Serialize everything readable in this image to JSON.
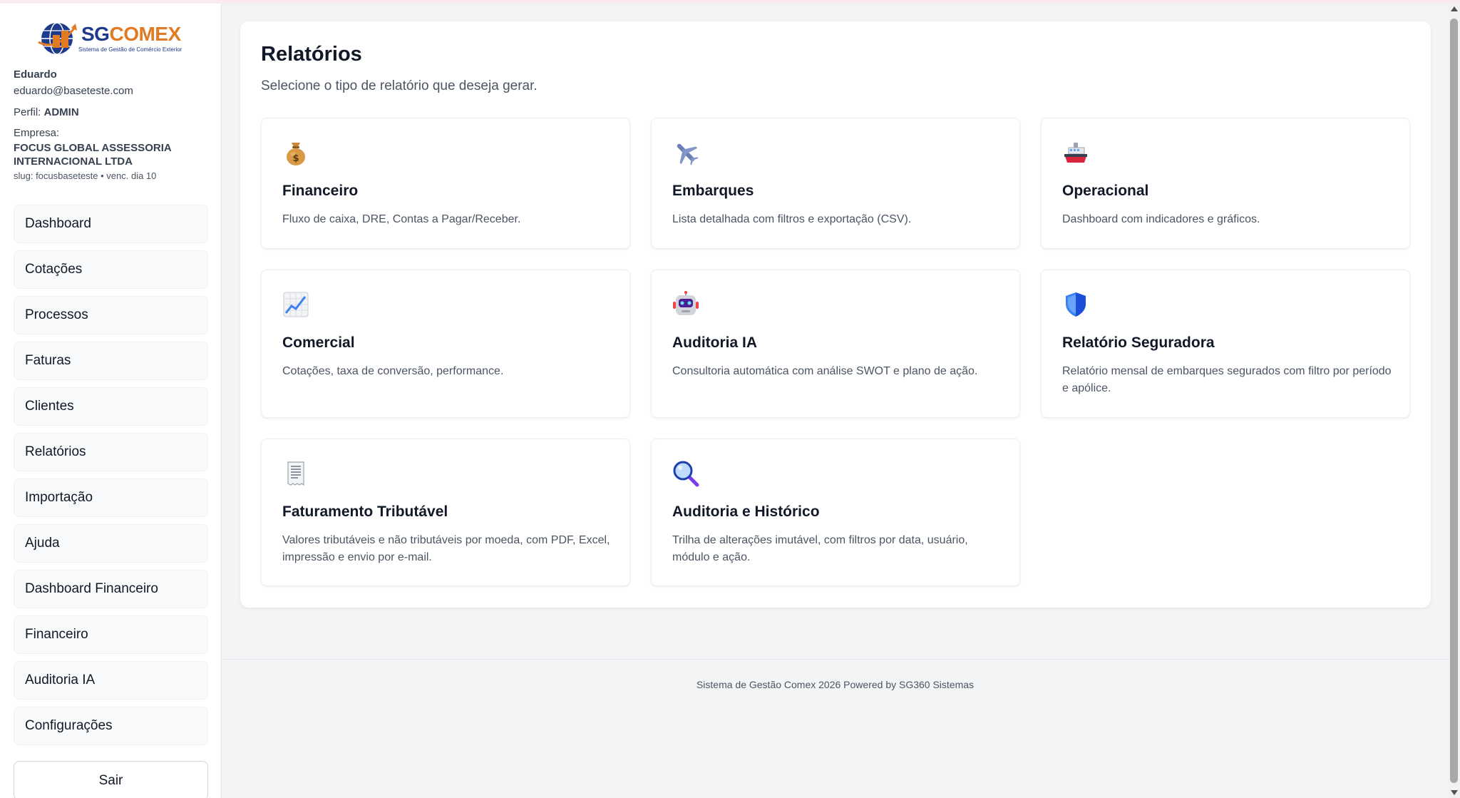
{
  "brand": {
    "sg": "SG",
    "comex": "COMEX",
    "tagline": "Sistema de Gestão de Comércio Exterior"
  },
  "user": {
    "name": "Eduardo",
    "email": "eduardo@baseteste.com",
    "perfil_label": "Perfil:",
    "perfil_value": "ADMIN",
    "empresa_label": "Empresa:",
    "empresa_name": "FOCUS GLOBAL ASSESSORIA INTERNACIONAL LTDA",
    "slug": "slug: focusbaseteste • venc. dia 10"
  },
  "nav": {
    "items": [
      {
        "label": "Dashboard"
      },
      {
        "label": "Cotações"
      },
      {
        "label": "Processos"
      },
      {
        "label": "Faturas"
      },
      {
        "label": "Clientes"
      },
      {
        "label": "Relatórios"
      },
      {
        "label": "Importação"
      },
      {
        "label": "Ajuda"
      },
      {
        "label": "Dashboard Financeiro"
      },
      {
        "label": "Financeiro"
      },
      {
        "label": "Auditoria IA"
      },
      {
        "label": "Configurações"
      }
    ],
    "logout": "Sair"
  },
  "page": {
    "title": "Relatórios",
    "subtitle": "Selecione o tipo de relatório que deseja gerar."
  },
  "cards": [
    {
      "icon": "money-bag-icon",
      "title": "Financeiro",
      "description": "Fluxo de caixa, DRE, Contas a Pagar/Receber."
    },
    {
      "icon": "airplane-icon",
      "title": "Embarques",
      "description": "Lista detalhada com filtros e exportação (CSV)."
    },
    {
      "icon": "ship-icon",
      "title": "Operacional",
      "description": "Dashboard com indicadores e gráficos."
    },
    {
      "icon": "chart-increasing-icon",
      "title": "Comercial",
      "description": "Cotações, taxa de conversão, performance."
    },
    {
      "icon": "robot-icon",
      "title": "Auditoria IA",
      "description": "Consultoria automática com análise SWOT e plano de ação."
    },
    {
      "icon": "shield-icon",
      "title": "Relatório Seguradora",
      "description": "Relatório mensal de embarques segurados com filtro por período e apólice."
    },
    {
      "icon": "receipt-icon",
      "title": "Faturamento Tributável",
      "description": "Valores tributáveis e não tributáveis por moeda, com PDF, Excel, impressão e envio por e-mail."
    },
    {
      "icon": "magnifying-glass-icon",
      "title": "Auditoria e Histórico",
      "description": "Trilha de alterações imutável, com filtros por data, usuário, módulo e ação."
    }
  ],
  "footer": {
    "text": "Sistema de Gestão Comex 2026 Powered by SG360 Sistemas"
  }
}
